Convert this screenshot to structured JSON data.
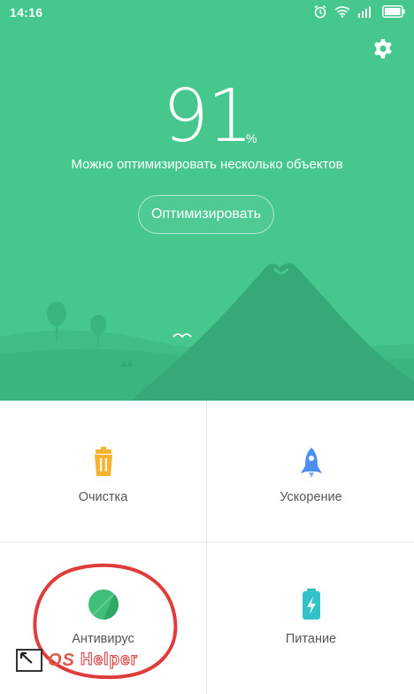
{
  "status_bar": {
    "time": "14:16",
    "icons": [
      "alarm-icon",
      "wifi-icon",
      "signal-icon",
      "battery-icon"
    ]
  },
  "header": {
    "score": "91",
    "score_unit": "%",
    "subtitle": "Можно оптимизировать несколько объектов",
    "optimize_button": "Оптимизировать",
    "settings_icon": "gear-icon"
  },
  "colors": {
    "primary": "#45c78e",
    "hill_dark": "#35a978",
    "hill_light": "#3fbd86",
    "cleanup_icon": "#f4b42f",
    "boost_icon": "#4b8ef0",
    "antivirus_icon": "#3fbf79",
    "power_icon": "#33c2c8",
    "highlight": "#e03c3c"
  },
  "tools": [
    {
      "label": "Очистка",
      "icon": "trash-icon"
    },
    {
      "label": "Ускорение",
      "icon": "rocket-icon"
    },
    {
      "label": "Антивирус",
      "icon": "shield-circle-icon"
    },
    {
      "label": "Питание",
      "icon": "battery-bolt-icon"
    }
  ],
  "watermark": {
    "os": "OS",
    "helper": "Helper"
  }
}
